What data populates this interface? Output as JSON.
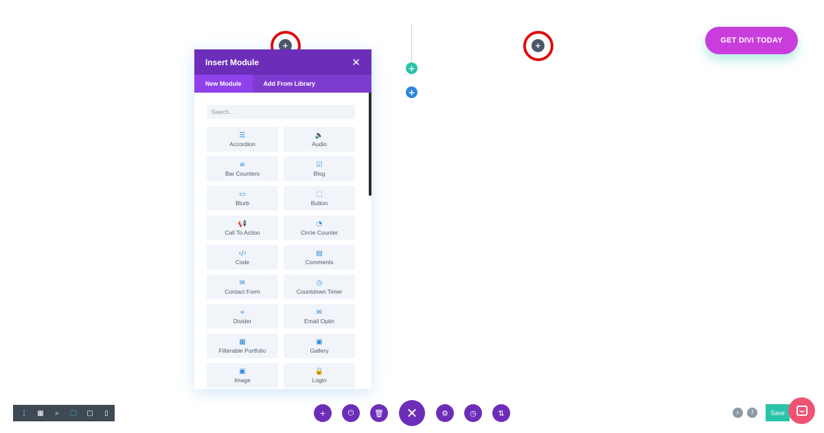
{
  "cta": {
    "label": "GET DIVI TODAY"
  },
  "canvas": {
    "top_add_icon": "+",
    "right_add_icon": "+",
    "green_add_icon": "+",
    "blue_add_icon": "+"
  },
  "modal": {
    "title": "Insert Module",
    "close_icon": "✕",
    "tabs": [
      {
        "label": "New Module"
      },
      {
        "label": "Add From Library"
      }
    ],
    "search_placeholder": "Search...",
    "modules": [
      {
        "label": "Accordion",
        "icon": "☰"
      },
      {
        "label": "Audio",
        "icon": "🔈"
      },
      {
        "label": "Bar Counters",
        "icon": "≡"
      },
      {
        "label": "Blog",
        "icon": "☑"
      },
      {
        "label": "Blurb",
        "icon": "▭"
      },
      {
        "label": "Button",
        "icon": "⬚"
      },
      {
        "label": "Call To Action",
        "icon": "📢"
      },
      {
        "label": "Circle Counter",
        "icon": "◔"
      },
      {
        "label": "Code",
        "icon": "‹/›"
      },
      {
        "label": "Comments",
        "icon": "▤"
      },
      {
        "label": "Contact Form",
        "icon": "✉"
      },
      {
        "label": "Countdown Timer",
        "icon": "◷"
      },
      {
        "label": "Divider",
        "icon": "÷"
      },
      {
        "label": "Email Optin",
        "icon": "✉"
      },
      {
        "label": "Filterable Portfolio",
        "icon": "▦"
      },
      {
        "label": "Gallery",
        "icon": "▣"
      },
      {
        "label": "Image",
        "icon": "▣"
      },
      {
        "label": "Login",
        "icon": "🔒"
      }
    ]
  },
  "left_toolbar": {
    "items": [
      {
        "icon": "⋮"
      },
      {
        "icon": "▦"
      },
      {
        "icon": "⌕"
      },
      {
        "icon": "🖵"
      },
      {
        "icon": "▢"
      },
      {
        "icon": "▯"
      }
    ]
  },
  "center_toolbar": {
    "add": "+",
    "power": "⏻",
    "trash": "🗑",
    "close": "✕",
    "settings": "⚙",
    "history": "◷",
    "portability": "⇅"
  },
  "right_toolbar": {
    "zoom_icon": "⌕",
    "help_icon": "?",
    "save_label": "Save"
  }
}
